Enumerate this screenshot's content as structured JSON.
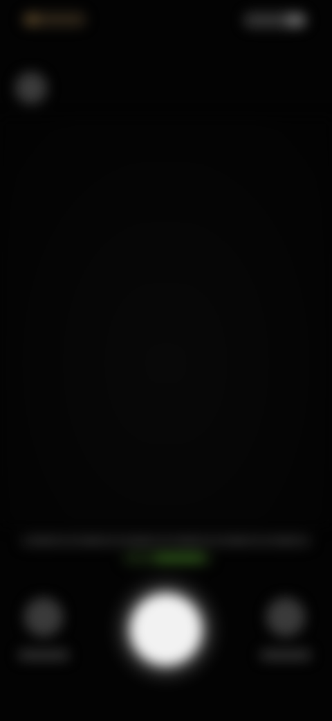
{
  "colors": {
    "background": "#030303",
    "shutter": "#f2f2f2",
    "mode_active": "#2f5a1a",
    "status_time_tint": "#7a5f35"
  },
  "icons": {
    "top_button": "round-button-icon",
    "left_control": "circle-control-icon",
    "right_control": "circle-control-icon",
    "shutter": "shutter-icon"
  }
}
